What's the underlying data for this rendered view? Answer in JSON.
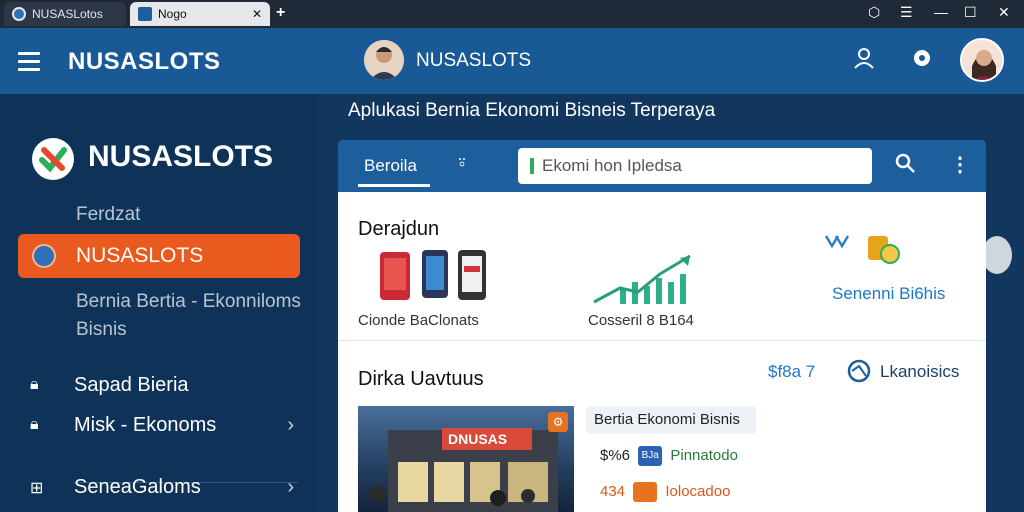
{
  "browser": {
    "tabs": [
      {
        "label": "NUSASLotos",
        "active": false
      },
      {
        "label": "Nogo",
        "active": true
      }
    ],
    "new_tab": "+",
    "window_controls": [
      "extensions-icon",
      "menu-icon",
      "minimize-icon",
      "maximize-icon",
      "close-icon"
    ]
  },
  "sidebar": {
    "header_title": "NUSASLOTS",
    "logo_text": "NUSASLOTS",
    "section_label": "Ferdzat",
    "active_item": "NUSASLOTS",
    "description": "Bernia Bertia - Ekonniloms Bisnis",
    "items": [
      {
        "label": "Sapad Bieria",
        "icon": "lock-icon",
        "chevron": false
      },
      {
        "label": "Misk - Ekonoms",
        "icon": "lock-icon",
        "chevron": true
      },
      {
        "label": "SeneaGaloms",
        "icon": "grid-icon",
        "chevron": true
      }
    ]
  },
  "main": {
    "header_title": "NUSASLOTS",
    "banner": "Aplukasi Bernia Ekonomi Bisneis Terperaya",
    "card": {
      "tab_label": "Beroila",
      "search_placeholder": "Ekomi hon Ipledsa",
      "featured_title": "Derajdun",
      "features": [
        {
          "caption": "Cionde BaClonats",
          "icon": "phones-icon"
        },
        {
          "caption": "Cosseril 8 B164",
          "icon": "growth-chart-icon"
        },
        {
          "caption": "Senenni Bi6his",
          "icon": "coins-icon"
        }
      ],
      "news_title": "Dirka Uavtuus",
      "news_stat": "$f8a 7",
      "news_stat_label": "Lkanoisics",
      "news_side_title": "Bertia Ekonomi Bisnis",
      "news_rows": [
        {
          "value": "$%6",
          "badge": "BJa",
          "label": "Pinnatodo",
          "color": "#2a7a3c",
          "badge_color": "#2b62b4"
        },
        {
          "value": "434",
          "badge": "",
          "label": "Iolocadoo",
          "color": "#d9571a",
          "badge_color": "#e5731f"
        }
      ],
      "news_image_sign": "DNUSAS"
    }
  },
  "colors": {
    "accent_orange": "#ea5a1e",
    "header_blue": "#195a96",
    "sidebar_navy": "#0f3358",
    "card_blue": "#1d5e9c"
  }
}
